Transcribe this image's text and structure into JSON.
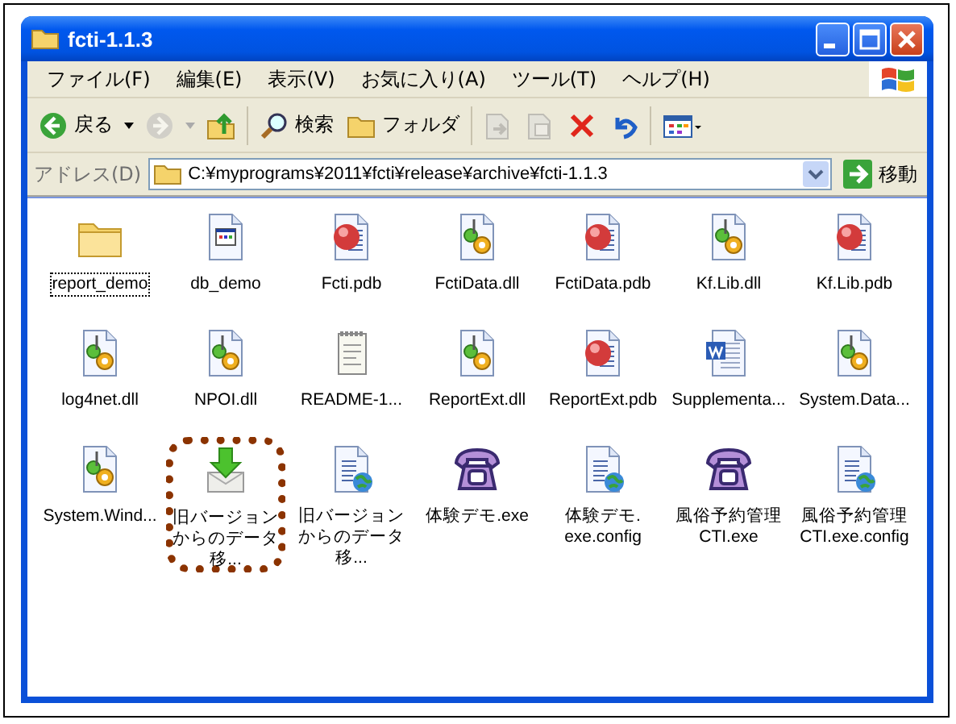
{
  "window": {
    "title": "fcti-1.1.3"
  },
  "menu": [
    "ファイル(F)",
    "編集(E)",
    "表示(V)",
    "お気に入り(A)",
    "ツール(T)",
    "ヘルプ(H)"
  ],
  "toolbar": [
    {
      "kind": "back",
      "label": "戻る",
      "disabled": false
    },
    {
      "kind": "forward",
      "disabled": true
    },
    {
      "kind": "up",
      "disabled": false
    },
    {
      "kind": "search",
      "label": "検索",
      "disabled": false
    },
    {
      "kind": "folders",
      "label": "フォルダ",
      "disabled": false
    },
    {
      "kind": "move",
      "disabled": true
    },
    {
      "kind": "copy",
      "disabled": true
    },
    {
      "kind": "delete",
      "disabled": false
    },
    {
      "kind": "undo",
      "disabled": false
    },
    {
      "kind": "views",
      "disabled": false
    }
  ],
  "address": {
    "label": "アドレス(D)",
    "value": "C:¥myprograms¥2011¥fcti¥release¥archive¥fcti-1.1.3",
    "go": "移動"
  },
  "files": [
    {
      "name": "report_demo",
      "kind": "folder",
      "focused": true,
      "highlighted": false
    },
    {
      "name": "db_demo",
      "kind": "app",
      "focused": false,
      "highlighted": false
    },
    {
      "name": "Fcti.pdb",
      "kind": "pdb",
      "focused": false,
      "highlighted": false
    },
    {
      "name": "FctiData.dll",
      "kind": "dll",
      "focused": false,
      "highlighted": false
    },
    {
      "name": "FctiData.pdb",
      "kind": "pdb",
      "focused": false,
      "highlighted": false
    },
    {
      "name": "Kf.Lib.dll",
      "kind": "dll",
      "focused": false,
      "highlighted": false
    },
    {
      "name": "Kf.Lib.pdb",
      "kind": "pdb",
      "focused": false,
      "highlighted": false
    },
    {
      "name": "log4net.dll",
      "kind": "dll",
      "focused": false,
      "highlighted": false
    },
    {
      "name": "NPOI.dll",
      "kind": "dll",
      "focused": false,
      "highlighted": false
    },
    {
      "name": "README-1...",
      "kind": "text",
      "focused": false,
      "highlighted": false
    },
    {
      "name": "ReportExt.dll",
      "kind": "dll",
      "focused": false,
      "highlighted": false
    },
    {
      "name": "ReportExt.pdb",
      "kind": "pdb",
      "focused": false,
      "highlighted": false
    },
    {
      "name": "Supplementa...",
      "kind": "word",
      "focused": false,
      "highlighted": false
    },
    {
      "name": "System.Data...",
      "kind": "dll",
      "focused": false,
      "highlighted": false
    },
    {
      "name": "System.Wind...",
      "kind": "dll",
      "focused": false,
      "highlighted": false
    },
    {
      "name": "旧バージョンからのデータ移...",
      "kind": "installer",
      "focused": false,
      "highlighted": true
    },
    {
      "name": "旧バージョンからのデータ移...",
      "kind": "config",
      "focused": false,
      "highlighted": false
    },
    {
      "name": "体験デモ.exe",
      "kind": "phone",
      "focused": false,
      "highlighted": false
    },
    {
      "name": "体験デモ.\nexe.config",
      "kind": "config",
      "focused": false,
      "highlighted": false
    },
    {
      "name": "風俗予約管理CTI.exe",
      "kind": "phone",
      "focused": false,
      "highlighted": false
    },
    {
      "name": "風俗予約管理CTI.exe.config",
      "kind": "config",
      "focused": false,
      "highlighted": false
    }
  ]
}
